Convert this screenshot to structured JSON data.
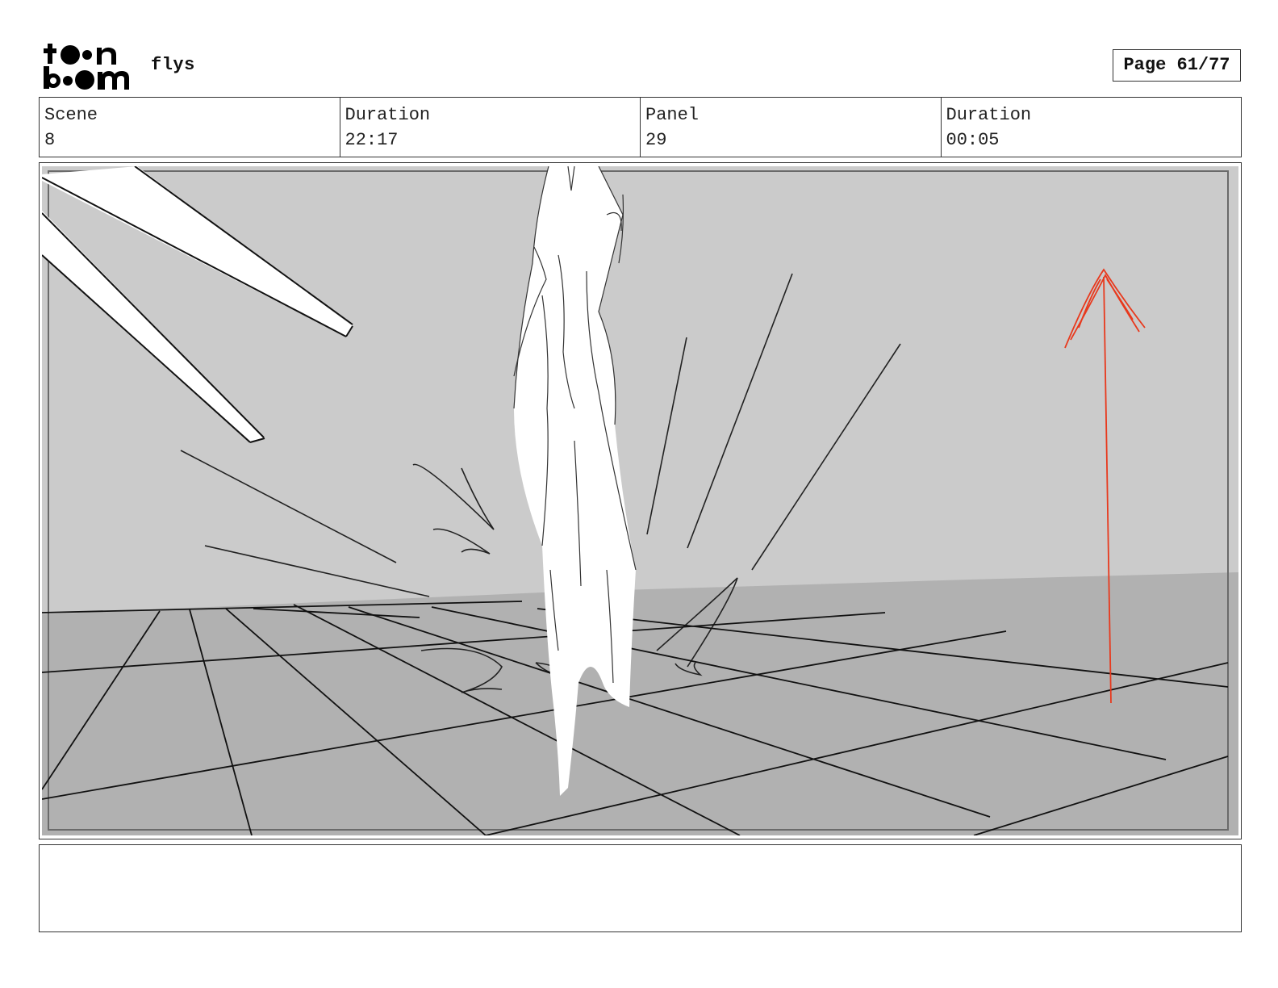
{
  "header": {
    "logo_text_top": "toon",
    "logo_text_bottom": "boom",
    "project_title": "flys",
    "page_label": "Page 61/77"
  },
  "info": {
    "scene_label": "Scene",
    "scene_value": "8",
    "scene_duration_label": "Duration",
    "scene_duration_value": "22:17",
    "panel_label": "Panel",
    "panel_value": "29",
    "panel_duration_label": "Duration",
    "panel_duration_value": "00:05"
  },
  "notes": {
    "text": ""
  },
  "colors": {
    "sky": "#cbcbcb",
    "ground": "#b1b1b1",
    "ink": "#111111",
    "arrow": "#e8391d"
  }
}
